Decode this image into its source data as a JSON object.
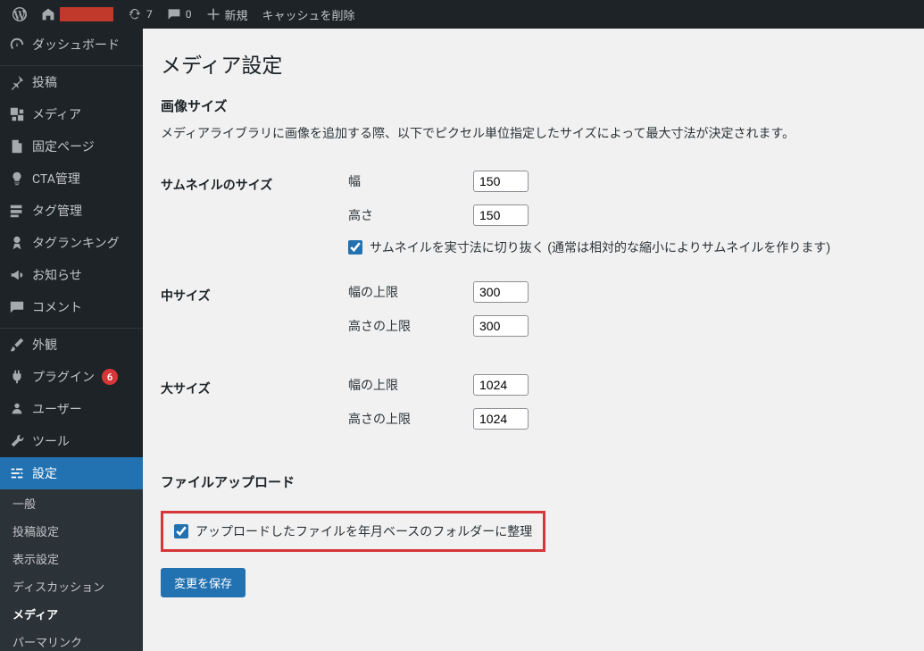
{
  "adminbar": {
    "updates_count": "7",
    "comments_count": "0",
    "new_label": "新規",
    "cache_label": "キャッシュを削除"
  },
  "sidebar": {
    "dashboard": "ダッシュボード",
    "posts": "投稿",
    "media": "メディア",
    "pages": "固定ページ",
    "cta": "CTA管理",
    "tags": "タグ管理",
    "tag_ranking": "タグランキング",
    "notices": "お知らせ",
    "comments": "コメント",
    "appearance": "外観",
    "plugins": "プラグイン",
    "plugins_badge": "6",
    "users": "ユーザー",
    "tools": "ツール",
    "settings": "設定",
    "submenu": {
      "general": "一般",
      "writing": "投稿設定",
      "reading": "表示設定",
      "discussion": "ディスカッション",
      "media": "メディア",
      "permalink": "パーマリンク"
    }
  },
  "page": {
    "title": "メディア設定",
    "section_image_sizes": "画像サイズ",
    "image_sizes_desc": "メディアライブラリに画像を追加する際、以下でピクセル単位指定したサイズによって最大寸法が決定されます。",
    "thumbnail": {
      "heading": "サムネイルのサイズ",
      "width_label": "幅",
      "width_value": "150",
      "height_label": "高さ",
      "height_value": "150",
      "crop_label": "サムネイルを実寸法に切り抜く (通常は相対的な縮小によりサムネイルを作ります)"
    },
    "medium": {
      "heading": "中サイズ",
      "width_label": "幅の上限",
      "width_value": "300",
      "height_label": "高さの上限",
      "height_value": "300"
    },
    "large": {
      "heading": "大サイズ",
      "width_label": "幅の上限",
      "width_value": "1024",
      "height_label": "高さの上限",
      "height_value": "1024"
    },
    "section_upload": "ファイルアップロード",
    "organize_label": "アップロードしたファイルを年月ベースのフォルダーに整理",
    "save_button": "変更を保存"
  }
}
